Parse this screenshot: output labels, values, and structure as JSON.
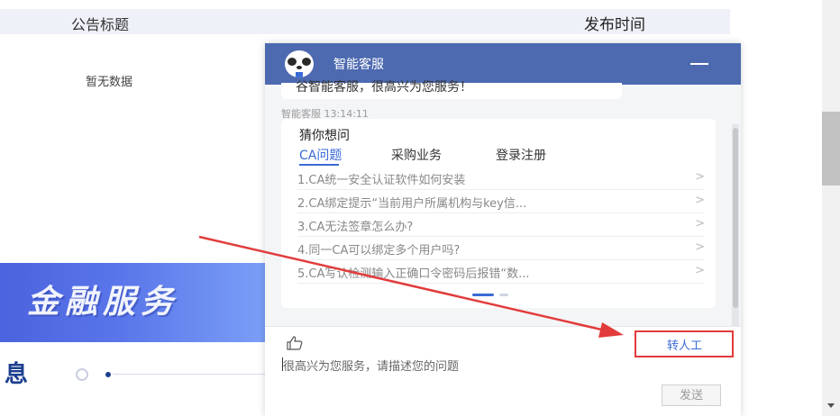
{
  "announcement": {
    "col_title": "公告标题",
    "col_time": "发布时间",
    "empty_text": "暂无数据"
  },
  "banner": {
    "text": "金融服务"
  },
  "section": {
    "title": "息"
  },
  "chat": {
    "title": "智能客服",
    "greeting": "谷智能客服，很高兴为您服务！",
    "meta": "智能客服  13:14:11",
    "guess_title": "猜你想问",
    "tabs": [
      "CA问题",
      "采购业务",
      "登录注册"
    ],
    "active_tab": "CA问题",
    "questions": [
      "1.CA统一安全认证软件如何安装",
      "2.CA绑定提示“当前用户所属机构与key信...",
      "3.CA无法签章怎么办?",
      "4.同一CA可以绑定多个用户吗?",
      "5.CA写认检测输入正确口令密码后报错“数..."
    ],
    "row_arrow": ">",
    "transfer_label": "转人工",
    "input_placeholder": "很高兴为您服务，请描述您的问题",
    "send_label": "发送"
  },
  "colors": {
    "chat_header": "#4d6ab0",
    "accent": "#3a6ad6",
    "highlight": "#e23b3b",
    "banner": "#5a76ea"
  },
  "icons": {
    "avatar": "panda-avatar-icon",
    "minimize": "minimize-icon",
    "like": "thumbs-up-icon",
    "row_arrow": "chevron-right-icon"
  }
}
